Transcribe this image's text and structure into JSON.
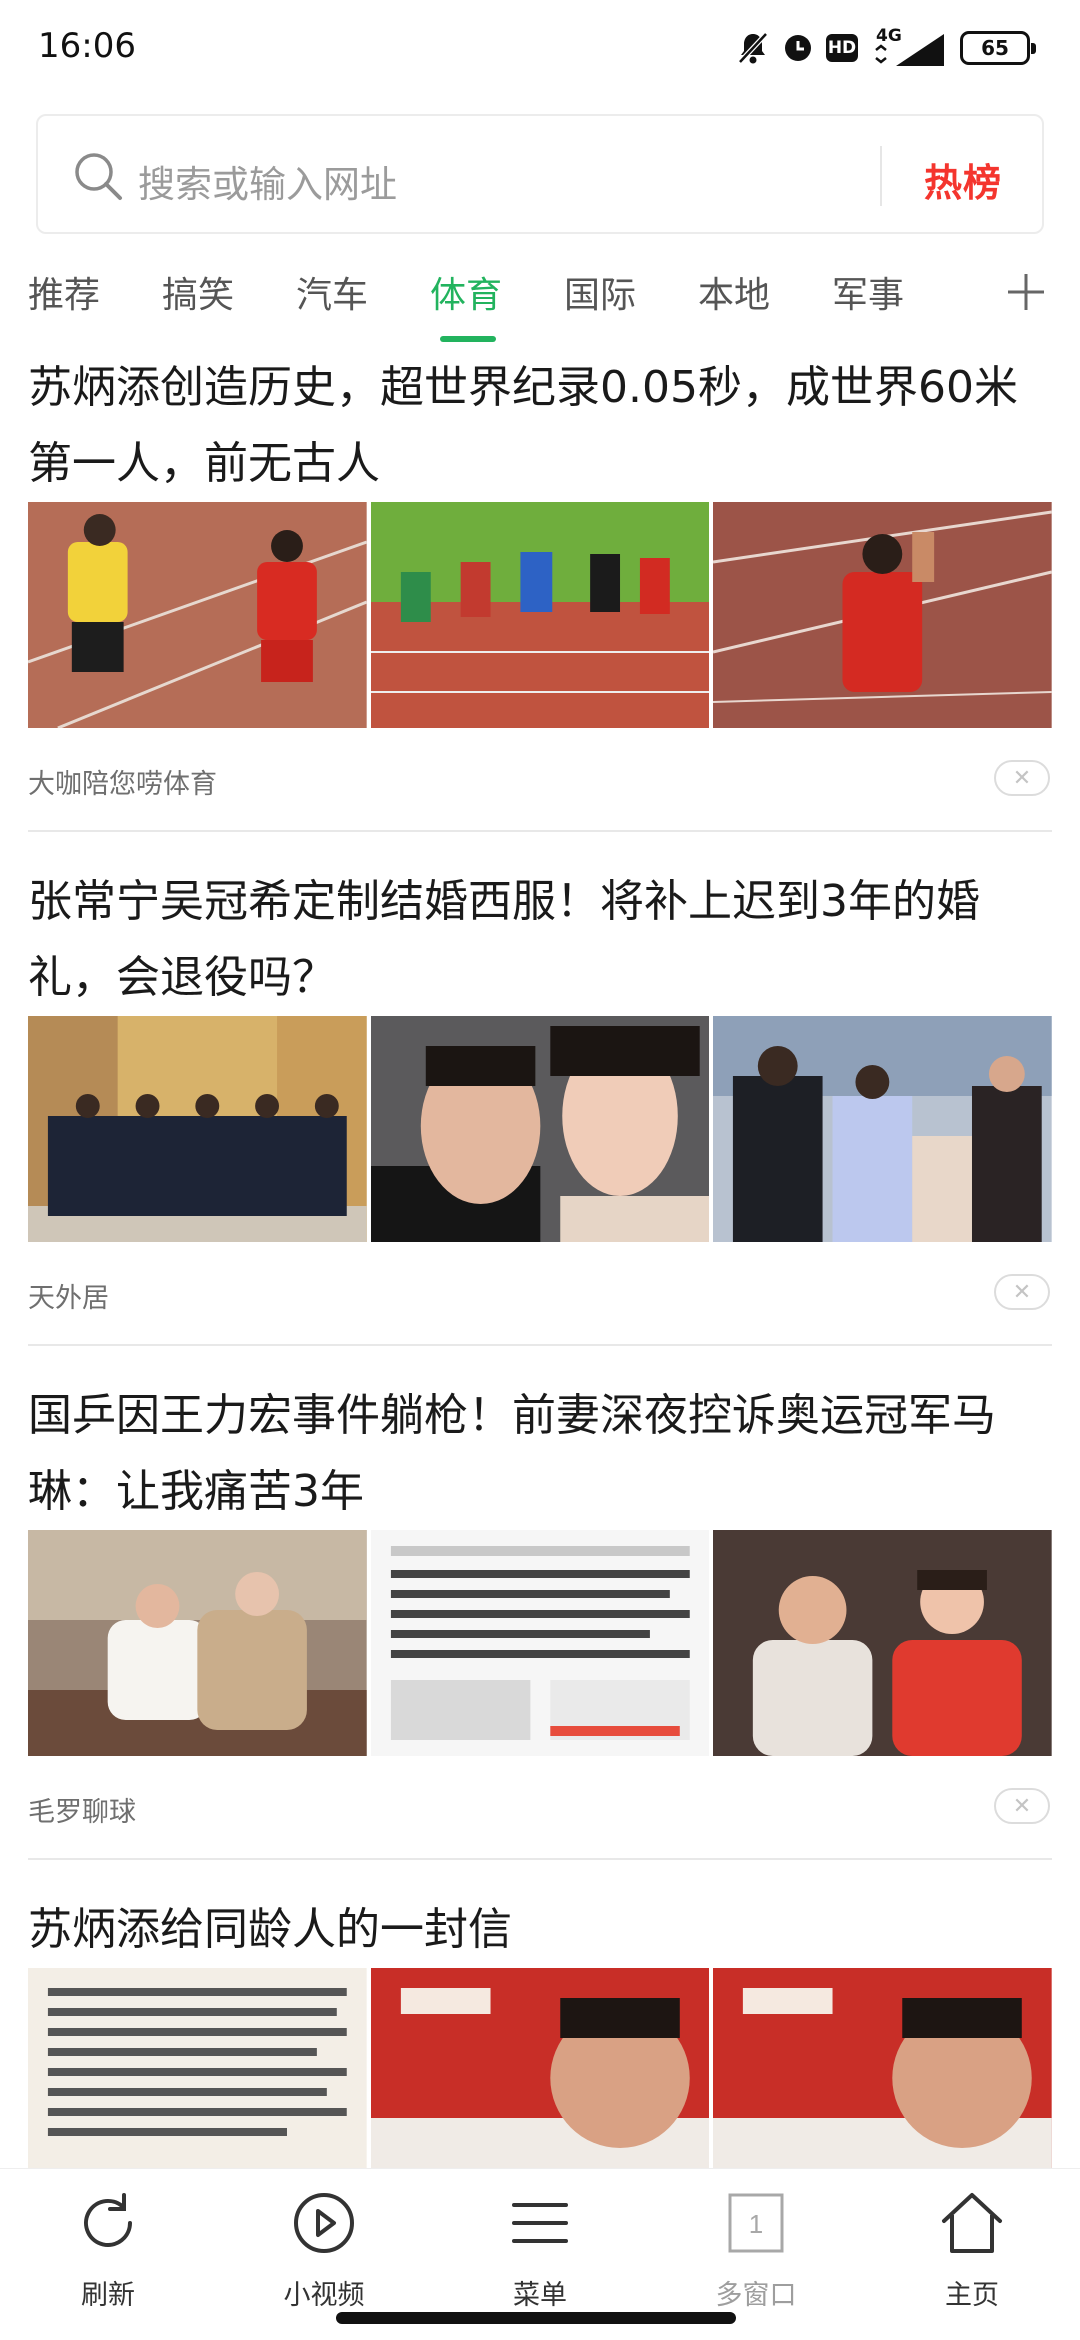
{
  "status_bar": {
    "time": "16:06",
    "network_label": "4G",
    "hd_label": "HD",
    "battery_level": "65"
  },
  "search": {
    "placeholder": "搜索或输入网址",
    "hot_list_label": "热榜"
  },
  "tabs": [
    {
      "label": "推荐"
    },
    {
      "label": "搞笑"
    },
    {
      "label": "汽车"
    },
    {
      "label": "体育",
      "active": true
    },
    {
      "label": "国际"
    },
    {
      "label": "本地"
    },
    {
      "label": "军事"
    }
  ],
  "articles": [
    {
      "title": "苏炳添创造历史，超世界纪录0.05秒，成世界60米第一人，前无古人",
      "source": "大咖陪您唠体育"
    },
    {
      "title": "张常宁吴冠希定制结婚西服！将补上迟到3年的婚礼，会退役吗？",
      "source": "天外居"
    },
    {
      "title": "国乒因王力宏事件躺枪！前妻深夜控诉奥运冠军马琳：让我痛苦3年",
      "source": "毛罗聊球"
    },
    {
      "title": "苏炳添给同龄人的一封信",
      "source": ""
    }
  ],
  "bottom_nav": [
    {
      "label": "刷新",
      "icon": "refresh-icon"
    },
    {
      "label": "小视频",
      "icon": "play-circle-icon"
    },
    {
      "label": "菜单",
      "icon": "menu-icon"
    },
    {
      "label": "多窗口",
      "icon": "window-count-icon",
      "count": "1"
    },
    {
      "label": "主页",
      "icon": "home-icon"
    }
  ],
  "colors": {
    "accent_green": "#22b35e",
    "hot_red": "#f4352e"
  }
}
